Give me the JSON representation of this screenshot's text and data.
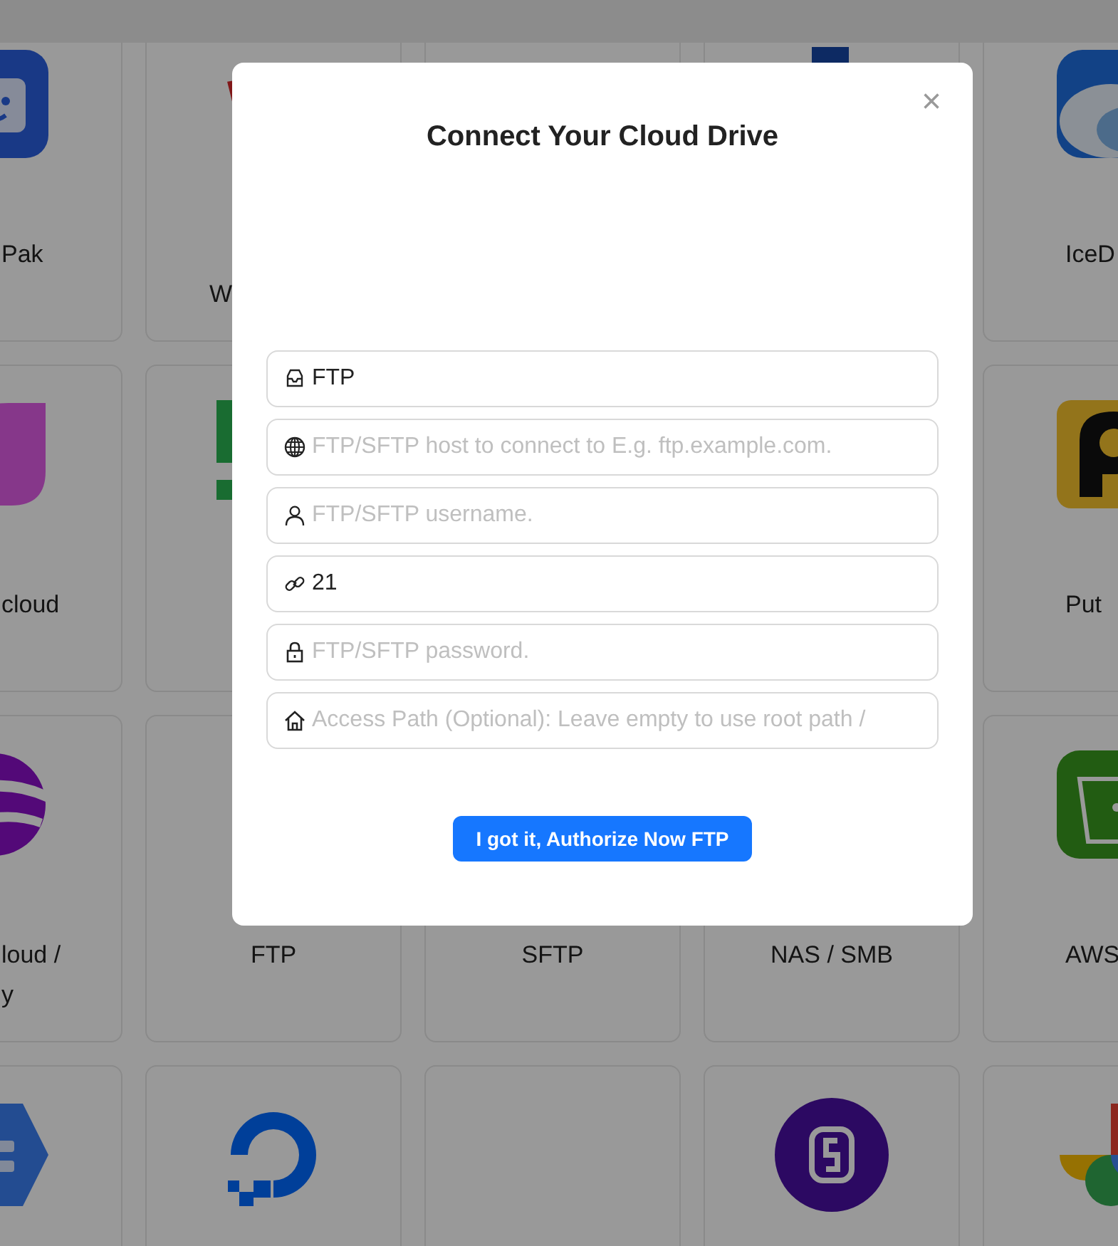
{
  "card_rows": [
    [
      {
        "label_lines": [
          "Pak"
        ]
      },
      {
        "label_lines": [
          "W"
        ]
      },
      {},
      {},
      {
        "label_lines": [
          "IceD"
        ]
      }
    ],
    [
      {
        "label_lines": [
          "cloud"
        ]
      },
      {},
      {},
      {},
      {
        "label_lines": [
          "Put"
        ]
      }
    ],
    [
      {
        "label_lines": [
          "loud /",
          "y"
        ]
      },
      {
        "label_lines": [
          "FTP"
        ]
      },
      {
        "label_lines": [
          "SFTP"
        ]
      },
      {
        "label_lines": [
          "NAS / SMB"
        ]
      },
      {
        "label_lines": [
          "AWS"
        ]
      }
    ],
    [
      {},
      {},
      {},
      {},
      {}
    ]
  ],
  "dialog": {
    "title": "Connect Your Cloud Drive",
    "close": "×",
    "fields": [
      {
        "value": "FTP"
      },
      {
        "placeholder": "FTP/SFTP host to connect to E.g. ftp.example.com."
      },
      {
        "placeholder": "FTP/SFTP username."
      },
      {
        "value": "21"
      },
      {
        "placeholder": "FTP/SFTP password."
      },
      {
        "placeholder": "Access Path (Optional): Leave empty to use root path /"
      }
    ],
    "button": "I got it, Authorize Now FTP"
  }
}
